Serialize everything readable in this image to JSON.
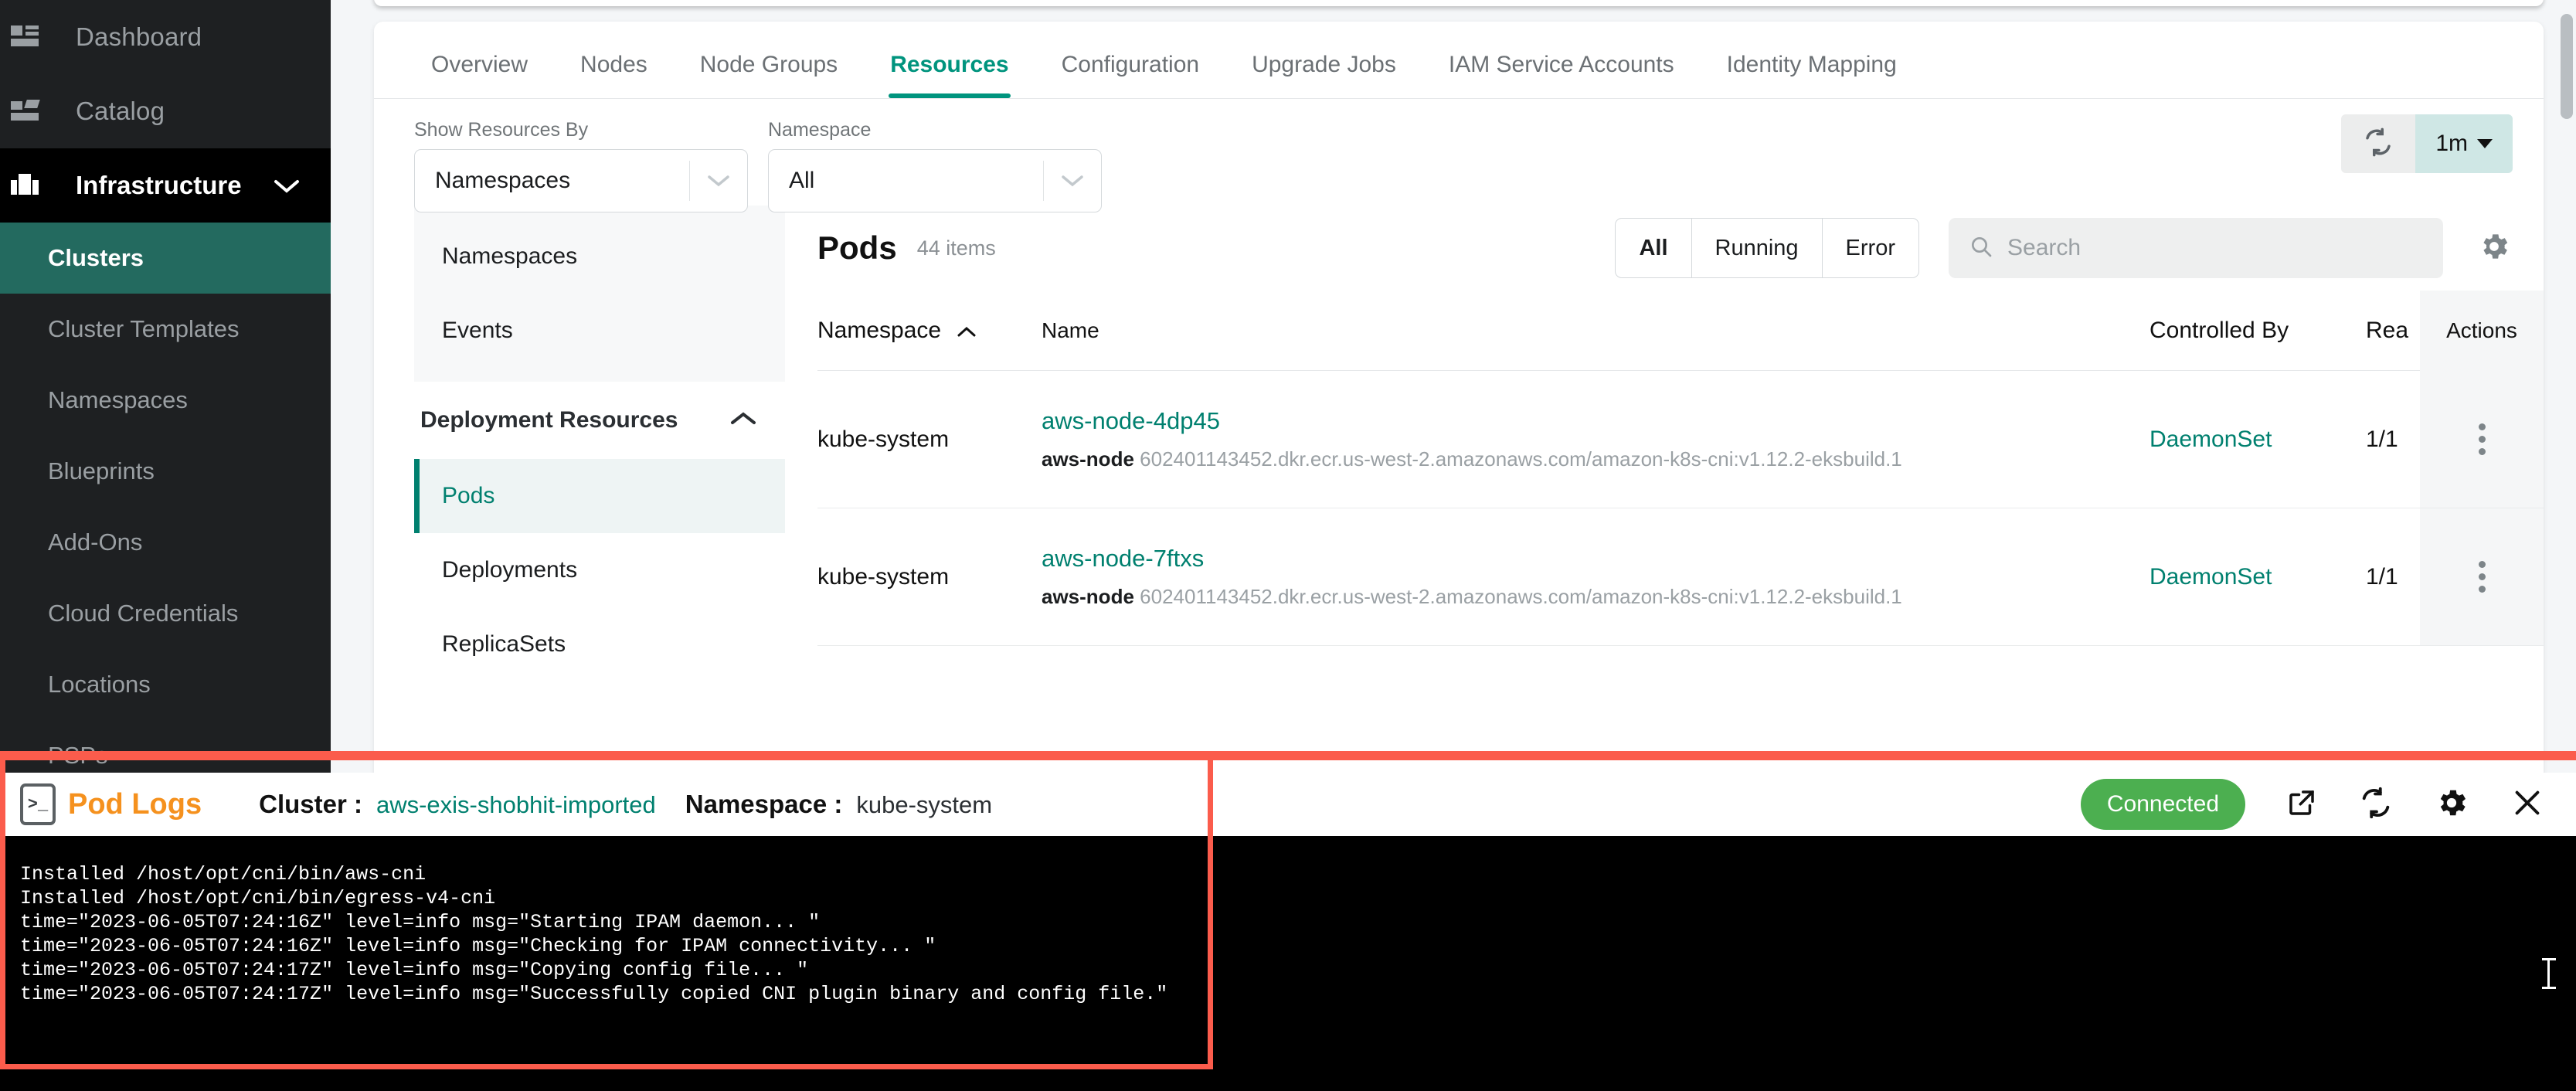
{
  "sidebar": {
    "top_items": [
      {
        "label": "Dashboard",
        "icon": "dashboard-icon"
      },
      {
        "label": "Catalog",
        "icon": "catalog-icon"
      }
    ],
    "section": {
      "label": "Infrastructure",
      "icon": "infrastructure-icon",
      "chevron": "chevron-down-icon"
    },
    "sub_items": [
      {
        "label": "Clusters",
        "active": true
      },
      {
        "label": "Cluster Templates",
        "active": false
      },
      {
        "label": "Namespaces",
        "active": false
      },
      {
        "label": "Blueprints",
        "active": false
      },
      {
        "label": "Add-Ons",
        "active": false
      },
      {
        "label": "Cloud Credentials",
        "active": false
      },
      {
        "label": "Locations",
        "active": false
      },
      {
        "label": "PSPs",
        "active": false
      }
    ]
  },
  "tabs": [
    {
      "label": "Overview",
      "active": false
    },
    {
      "label": "Nodes",
      "active": false
    },
    {
      "label": "Node Groups",
      "active": false
    },
    {
      "label": "Resources",
      "active": true
    },
    {
      "label": "Configuration",
      "active": false
    },
    {
      "label": "Upgrade Jobs",
      "active": false
    },
    {
      "label": "IAM Service Accounts",
      "active": false
    },
    {
      "label": "Identity Mapping",
      "active": false
    }
  ],
  "filters": {
    "show_resources_by": {
      "label": "Show Resources By",
      "value": "Namespaces"
    },
    "namespace": {
      "label": "Namespace",
      "value": "All"
    },
    "refresh_icon": "refresh-icon",
    "refresh_interval": "1m"
  },
  "inner_nav": {
    "group_items": [
      "Namespaces",
      "Events"
    ],
    "section_label": "Deployment Resources",
    "section_chevron": "chevron-up-icon",
    "sub_items": [
      {
        "label": "Pods",
        "active": true
      },
      {
        "label": "Deployments",
        "active": false
      },
      {
        "label": "ReplicaSets",
        "active": false
      }
    ]
  },
  "table_panel": {
    "title": "Pods",
    "count": "44 items",
    "status_filters": [
      {
        "label": "All",
        "active": true
      },
      {
        "label": "Running",
        "active": false
      },
      {
        "label": "Error",
        "active": false
      }
    ],
    "search_placeholder": "Search",
    "search_value": "",
    "settings_icon": "gear-icon",
    "columns": [
      "Namespace",
      "Name",
      "Controlled By",
      "Rea",
      "Actions"
    ],
    "sort_column": "Namespace",
    "sort_direction": "asc",
    "rows": [
      {
        "namespace": "kube-system",
        "name": "aws-node-4dp45",
        "container": "aws-node",
        "image": "602401143452.dkr.ecr.us-west-2.amazonaws.com/amazon-k8s-cni:v1.12.2-eksbuild.1",
        "controlled_by": "DaemonSet",
        "ready": "1/1",
        "actions_icon": "kebab-menu-icon"
      },
      {
        "namespace": "kube-system",
        "name": "aws-node-7ftxs",
        "container": "aws-node",
        "image": "602401143452.dkr.ecr.us-west-2.amazonaws.com/amazon-k8s-cni:v1.12.2-eksbuild.1",
        "controlled_by": "DaemonSet",
        "ready": "1/1",
        "actions_icon": "kebab-menu-icon"
      }
    ]
  },
  "pod_logs": {
    "icon": "terminal-icon",
    "title": "Pod Logs",
    "cluster_label": "Cluster :",
    "cluster_value": "aws-exis-shobhit-imported",
    "namespace_label": "Namespace :",
    "namespace_value": "kube-system",
    "status": "Connected",
    "status_color": "#4caf50",
    "actions": [
      {
        "name": "open-external-icon"
      },
      {
        "name": "refresh-icon"
      },
      {
        "name": "gear-icon"
      },
      {
        "name": "close-icon"
      }
    ],
    "lines": [
      "Installed /host/opt/cni/bin/aws-cni",
      "Installed /host/opt/cni/bin/egress-v4-cni",
      "time=\"2023-06-05T07:24:16Z\" level=info msg=\"Starting IPAM daemon... \"",
      "time=\"2023-06-05T07:24:16Z\" level=info msg=\"Checking for IPAM connectivity... \"",
      "time=\"2023-06-05T07:24:17Z\" level=info msg=\"Copying config file... \"",
      "time=\"2023-06-05T07:24:17Z\" level=info msg=\"Successfully copied CNI plugin binary and config file.\""
    ]
  },
  "highlight_color": "#fb5c4c",
  "accent_color": "#00806f"
}
